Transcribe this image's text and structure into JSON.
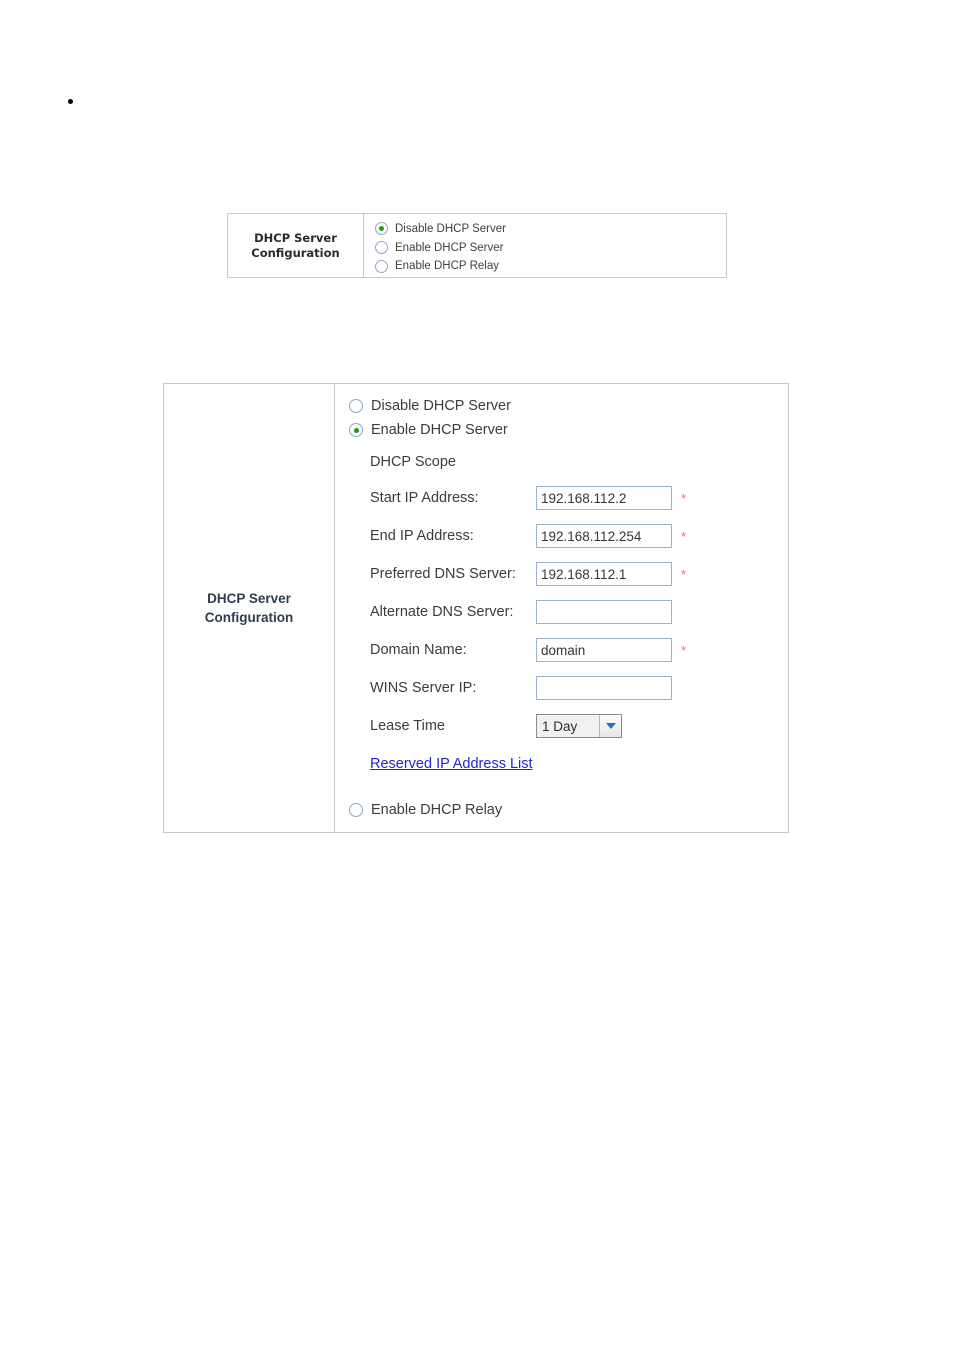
{
  "bullet": {
    "text": ""
  },
  "table_small": {
    "label": "DHCP Server\nConfiguration",
    "label_line1": "DHCP Server",
    "label_line2": "Configuration",
    "options": [
      {
        "label": "Disable DHCP Server",
        "selected": true
      },
      {
        "label": "Enable DHCP Server",
        "selected": false
      },
      {
        "label": "Enable DHCP Relay",
        "selected": false
      }
    ]
  },
  "table_large": {
    "label_line1": "DHCP Server",
    "label_line2": "Configuration",
    "option_disable": {
      "label": "Disable DHCP Server",
      "selected": false
    },
    "option_enable": {
      "label": "Enable DHCP Server",
      "selected": true
    },
    "option_relay": {
      "label": "Enable DHCP Relay",
      "selected": false
    },
    "scope_heading": "DHCP Scope",
    "fields": [
      {
        "label": "Start IP Address:",
        "value": "192.168.112.2",
        "placeholder": "",
        "required": true
      },
      {
        "label": "End IP Address:",
        "value": "192.168.112.254",
        "placeholder": "",
        "required": true
      },
      {
        "label": "Preferred DNS Server:",
        "value": "192.168.112.1",
        "placeholder": "",
        "required": true
      },
      {
        "label": "Alternate DNS Server:",
        "value": "",
        "placeholder": "",
        "required": false
      },
      {
        "label": "Domain Name:",
        "value": "domain",
        "placeholder": "",
        "required": true
      },
      {
        "label": "WINS Server IP:",
        "value": "",
        "placeholder": "",
        "required": false
      }
    ],
    "lease_time": {
      "label": "Lease Time",
      "selected": "1 Day",
      "options": [
        "1 Day"
      ]
    },
    "reserved_link": "Reserved IP Address List",
    "required_marker": "*"
  },
  "colors": {
    "table_border": "#c8c8c8",
    "input_border": "#9db2cc",
    "radio_ring": "#8fa9c4",
    "radio_dot": "#16a016",
    "required_star": "#f4696e",
    "link": "#2424d8",
    "label_text": "#313d4f",
    "body_text": "#3c3c3c"
  }
}
